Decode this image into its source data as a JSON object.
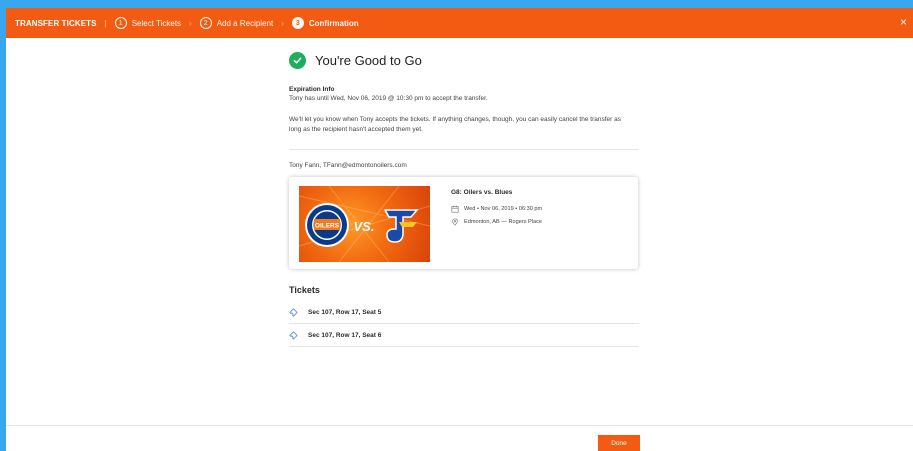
{
  "header": {
    "title": "TRANSFER TICKETS",
    "steps": [
      {
        "number": "1",
        "label": "Select Tickets"
      },
      {
        "number": "2",
        "label": "Add a Recipient"
      },
      {
        "number": "3",
        "label": "Confirmation"
      }
    ],
    "close_glyph": "×",
    "accent": "#f35b12"
  },
  "confirmation": {
    "heading": "You're Good to Go",
    "expiration_title": "Expiration Info",
    "expiration_text": "Tony has until Wed, Nov 06, 2019 @ 10:30 pm to accept the transfer.",
    "note": "We'll let you know when Tony accepts the tickets. If anything changes, though, you can easily cancel the transfer as long as the recipient hasn't accepted them yet.",
    "recipient": "Tony Fann, TFann@edmontonoilers.com"
  },
  "event": {
    "title": "G8: Oilers vs. Blues",
    "date": "Wed • Nov 06, 2019 • 06:30 pm",
    "location": "Edmonton, AB — Rogers Place",
    "image_text": {
      "home": "OILERS",
      "vs": "VS."
    }
  },
  "tickets": {
    "heading": "Tickets",
    "items": [
      {
        "label": "Sec 107, Row 17, Seat 5"
      },
      {
        "label": "Sec 107, Row 17, Seat 6"
      }
    ]
  },
  "footer": {
    "done_label": "Done"
  },
  "colors": {
    "background": "#39a7f0",
    "success": "#1fae5b"
  },
  "icons": [
    "close-icon",
    "check-icon",
    "calendar-icon",
    "location-pin-icon",
    "ticket-icon",
    "chevron-right-icon"
  ]
}
